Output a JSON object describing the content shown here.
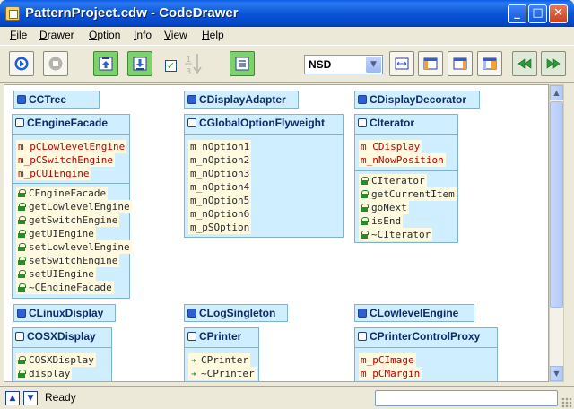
{
  "window": {
    "title": "PatternProject.cdw - CodeDrawer",
    "minimize": "_",
    "maximize": "□",
    "close": "✕"
  },
  "menu": [
    {
      "label": "File",
      "u": "F",
      "rest": "ile"
    },
    {
      "label": "Drawer",
      "u": "D",
      "rest": "rawer"
    },
    {
      "label": "Option",
      "u": "O",
      "rest": "ption"
    },
    {
      "label": "Info",
      "u": "I",
      "rest": "nfo"
    },
    {
      "label": "View",
      "u": "V",
      "rest": "iew"
    },
    {
      "label": "Help",
      "u": "H",
      "rest": "elp"
    }
  ],
  "toolbar": {
    "diagram_type": "NSD",
    "checkbox_checked": true,
    "icons": [
      "play-icon",
      "stop-icon",
      "move-up-icon",
      "move-down-icon",
      "reorder-icon",
      "list-icon",
      "fit-width-icon",
      "layout-left-icon",
      "layout-right-icon",
      "layout-split-icon",
      "rewind-icon",
      "forward-icon"
    ]
  },
  "classes_collapsed": [
    {
      "name": "CCTree"
    },
    {
      "name": "CDisplayAdapter"
    },
    {
      "name": "CDisplayDecorator"
    },
    {
      "name": "CLinuxDisplay"
    },
    {
      "name": "CLogSingleton"
    },
    {
      "name": "CLowlevelEngine"
    }
  ],
  "classes": {
    "engine_facade": {
      "name": "CEngineFacade",
      "fields": [
        "m_pCLowlevelEngine",
        "m_pCSwitchEngine",
        "m_pCUIEngine"
      ],
      "methods": [
        "CEngineFacade",
        "getLowlevelEngine",
        "getSwitchEngine",
        "getUIEngine",
        "setLowlevelEngine",
        "setSwitchEngine",
        "setUIEngine",
        "~CEngineFacade"
      ]
    },
    "global_option": {
      "name": "CGlobalOptionFlyweight",
      "fields": [
        "m_nOption1",
        "m_nOption2",
        "m_nOption3",
        "m_nOption4",
        "m_nOption5",
        "m_nOption6",
        "m_pSOption"
      ]
    },
    "iterator": {
      "name": "CIterator",
      "fields": [
        "m_CDisplay",
        "m_nNowPosition"
      ],
      "methods": [
        "CIterator",
        "getCurrentItem",
        "goNext",
        "isEnd",
        "~CIterator"
      ]
    },
    "osx_display": {
      "name": "COSXDisplay",
      "methods": [
        "COSXDisplay",
        "display"
      ]
    },
    "printer": {
      "name": "CPrinter",
      "methods": [
        "CPrinter",
        "~CPrinter"
      ]
    },
    "printer_proxy": {
      "name": "CPrinterControlProxy",
      "fields": [
        "m_pCImage",
        "m_pCMargin"
      ]
    }
  },
  "status": {
    "text": "Ready",
    "up": "▲",
    "down": "▼"
  },
  "colors": {
    "class_fill": "#cfeeff",
    "field_text": "#c00000",
    "row_fill": "#fff9e0",
    "titlebar": "#0c54d6"
  }
}
